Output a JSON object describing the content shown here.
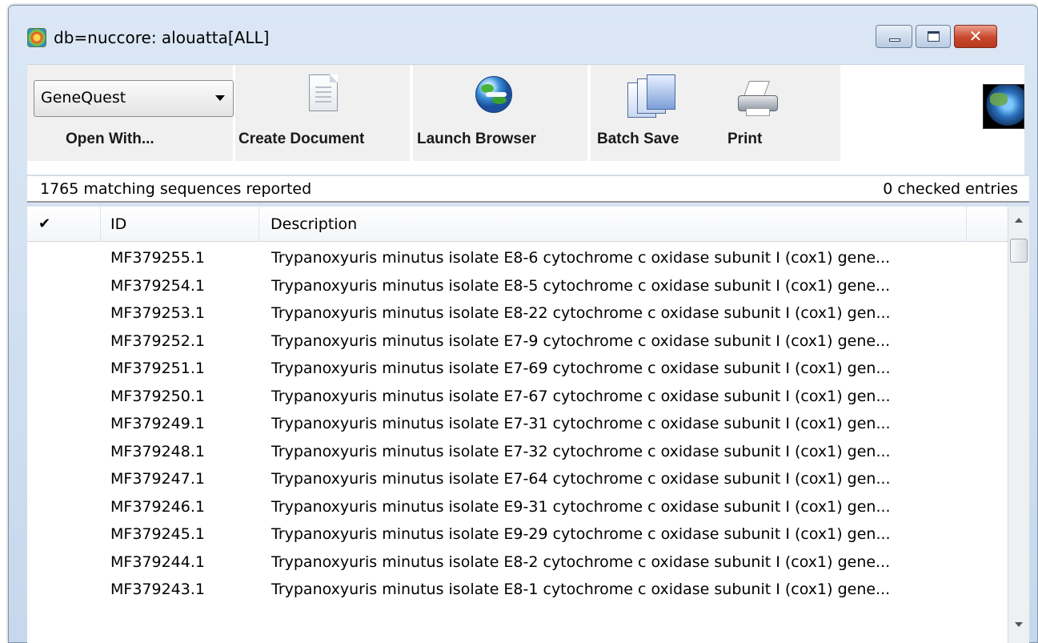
{
  "window": {
    "title": "db=nuccore: alouatta[ALL]"
  },
  "toolbar": {
    "open_with_select": "GeneQuest",
    "open_with_label": "Open With...",
    "create_document_label": "Create Document",
    "launch_browser_label": "Launch Browser",
    "batch_save_label": "Batch Save",
    "print_label": "Print"
  },
  "status": {
    "matching": "1765 matching sequences reported",
    "checked": "0  checked entries"
  },
  "table": {
    "columns": {
      "check": "✔",
      "id": "ID",
      "description": "Description"
    },
    "rows": [
      {
        "id": "MF379255.1",
        "description": "Trypanoxyuris minutus isolate E8-6 cytochrome c oxidase subunit I (cox1) gene..."
      },
      {
        "id": "MF379254.1",
        "description": "Trypanoxyuris minutus isolate E8-5 cytochrome c oxidase subunit I (cox1) gene..."
      },
      {
        "id": "MF379253.1",
        "description": "Trypanoxyuris minutus isolate E8-22 cytochrome c oxidase subunit I (cox1) gen..."
      },
      {
        "id": "MF379252.1",
        "description": "Trypanoxyuris minutus isolate E7-9 cytochrome c oxidase subunit I (cox1) gene..."
      },
      {
        "id": "MF379251.1",
        "description": "Trypanoxyuris minutus isolate E7-69 cytochrome c oxidase subunit I (cox1) gen..."
      },
      {
        "id": "MF379250.1",
        "description": "Trypanoxyuris minutus isolate E7-67 cytochrome c oxidase subunit I (cox1) gen..."
      },
      {
        "id": "MF379249.1",
        "description": "Trypanoxyuris minutus isolate E7-31 cytochrome c oxidase subunit I (cox1) gen..."
      },
      {
        "id": "MF379248.1",
        "description": "Trypanoxyuris minutus isolate E7-32 cytochrome c oxidase subunit I (cox1) gen..."
      },
      {
        "id": "MF379247.1",
        "description": "Trypanoxyuris minutus isolate E7-64 cytochrome c oxidase subunit I (cox1) gen..."
      },
      {
        "id": "MF379246.1",
        "description": "Trypanoxyuris minutus isolate E9-31 cytochrome c oxidase subunit I (cox1) gen..."
      },
      {
        "id": "MF379245.1",
        "description": "Trypanoxyuris minutus isolate E9-29 cytochrome c oxidase subunit I (cox1) gen..."
      },
      {
        "id": "MF379244.1",
        "description": "Trypanoxyuris minutus isolate E8-2 cytochrome c oxidase subunit I (cox1) gene..."
      },
      {
        "id": "MF379243.1",
        "description": "Trypanoxyuris minutus isolate E8-1 cytochrome c oxidase subunit I (cox1) gene..."
      }
    ]
  }
}
